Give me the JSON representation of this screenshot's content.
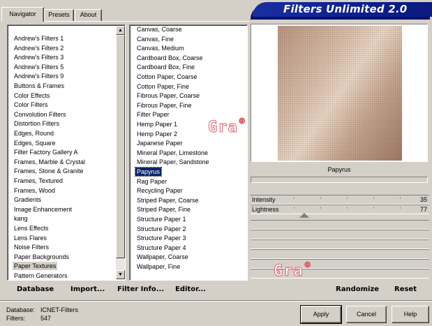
{
  "tabs": [
    {
      "label": "Navigator",
      "active": true
    },
    {
      "label": "Presets",
      "active": false
    },
    {
      "label": "About",
      "active": false
    }
  ],
  "banner": {
    "title": "Filters Unlimited 2.0"
  },
  "categories": {
    "items": [
      "Andrew's Filters 1",
      "Andrew's Filters 2",
      "Andrew's Filters 3",
      "Andrew's Filters 5",
      "Andrew's Filters 9",
      "Buttons & Frames",
      "Color Effects",
      "Color Filters",
      "Convolution Filters",
      "Distortion Filters",
      "Edges, Round",
      "Edges, Square",
      "Filter Factory Gallery A",
      "Frames, Marble & Crystal",
      "Frames, Stone & Granite",
      "Frames, Textured",
      "Frames, Wood",
      "Gradients",
      "Image Enhancement",
      "kang",
      "Lens Effects",
      "Lens Flares",
      "Noise Filters",
      "Paper Backgrounds",
      "Paper Textures",
      "Pattern Generators"
    ],
    "selected": "Paper Textures"
  },
  "filters": {
    "items": [
      "Canvas, Coarse",
      "Canvas, Fine",
      "Canvas, Medium",
      "Cardboard Box, Coarse",
      "Cardboard Box, Fine",
      "Cotton Paper, Coarse",
      "Cotton Paper, Fine",
      "Fibrous Paper, Coarse",
      "Fibrous Paper, Fine",
      "Filter Paper",
      "Hemp Paper 1",
      "Hemp Paper 2",
      "Japanese Paper",
      "Mineral Paper, Limestone",
      "Mineral Paper, Sandstone",
      "Papyrus",
      "Rag Paper",
      "Recycling Paper",
      "Striped Paper, Coarse",
      "Striped Paper, Fine",
      "Structure Paper 1",
      "Structure Paper 2",
      "Structure Paper 3",
      "Structure Paper 4",
      "Wallpaper, Coarse",
      "Wallpaper, Fine"
    ],
    "selected": "Papyrus"
  },
  "preview": {
    "filter_name": "Papyrus"
  },
  "sliders": [
    {
      "label": "Intensity",
      "value": "35",
      "max": 255
    },
    {
      "label": "Lightness",
      "value": "77",
      "max": 255
    }
  ],
  "actions": {
    "database": "Database",
    "import": "Import...",
    "filter_info": "Filter Info...",
    "editor": "Editor...",
    "randomize": "Randomize",
    "reset": "Reset"
  },
  "info": {
    "database_label": "Database:",
    "database_value": "ICNET-Filters",
    "filters_label": "Filters:",
    "filters_value": "547"
  },
  "buttons": {
    "apply": "Apply",
    "cancel": "Cancel",
    "help": "Help"
  },
  "watermark": {
    "text": "Gra",
    "mark": "®"
  }
}
